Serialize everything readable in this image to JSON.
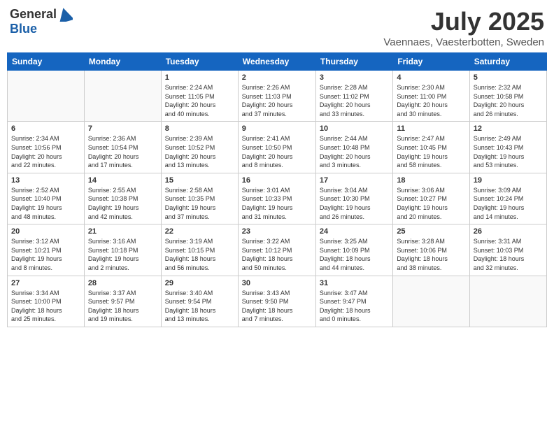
{
  "header": {
    "logo_general": "General",
    "logo_blue": "Blue",
    "month": "July 2025",
    "location": "Vaennaes, Vaesterbotten, Sweden"
  },
  "weekdays": [
    "Sunday",
    "Monday",
    "Tuesday",
    "Wednesday",
    "Thursday",
    "Friday",
    "Saturday"
  ],
  "weeks": [
    [
      {
        "day": "",
        "info": ""
      },
      {
        "day": "",
        "info": ""
      },
      {
        "day": "1",
        "info": "Sunrise: 2:24 AM\nSunset: 11:05 PM\nDaylight: 20 hours\nand 40 minutes."
      },
      {
        "day": "2",
        "info": "Sunrise: 2:26 AM\nSunset: 11:03 PM\nDaylight: 20 hours\nand 37 minutes."
      },
      {
        "day": "3",
        "info": "Sunrise: 2:28 AM\nSunset: 11:02 PM\nDaylight: 20 hours\nand 33 minutes."
      },
      {
        "day": "4",
        "info": "Sunrise: 2:30 AM\nSunset: 11:00 PM\nDaylight: 20 hours\nand 30 minutes."
      },
      {
        "day": "5",
        "info": "Sunrise: 2:32 AM\nSunset: 10:58 PM\nDaylight: 20 hours\nand 26 minutes."
      }
    ],
    [
      {
        "day": "6",
        "info": "Sunrise: 2:34 AM\nSunset: 10:56 PM\nDaylight: 20 hours\nand 22 minutes."
      },
      {
        "day": "7",
        "info": "Sunrise: 2:36 AM\nSunset: 10:54 PM\nDaylight: 20 hours\nand 17 minutes."
      },
      {
        "day": "8",
        "info": "Sunrise: 2:39 AM\nSunset: 10:52 PM\nDaylight: 20 hours\nand 13 minutes."
      },
      {
        "day": "9",
        "info": "Sunrise: 2:41 AM\nSunset: 10:50 PM\nDaylight: 20 hours\nand 8 minutes."
      },
      {
        "day": "10",
        "info": "Sunrise: 2:44 AM\nSunset: 10:48 PM\nDaylight: 20 hours\nand 3 minutes."
      },
      {
        "day": "11",
        "info": "Sunrise: 2:47 AM\nSunset: 10:45 PM\nDaylight: 19 hours\nand 58 minutes."
      },
      {
        "day": "12",
        "info": "Sunrise: 2:49 AM\nSunset: 10:43 PM\nDaylight: 19 hours\nand 53 minutes."
      }
    ],
    [
      {
        "day": "13",
        "info": "Sunrise: 2:52 AM\nSunset: 10:40 PM\nDaylight: 19 hours\nand 48 minutes."
      },
      {
        "day": "14",
        "info": "Sunrise: 2:55 AM\nSunset: 10:38 PM\nDaylight: 19 hours\nand 42 minutes."
      },
      {
        "day": "15",
        "info": "Sunrise: 2:58 AM\nSunset: 10:35 PM\nDaylight: 19 hours\nand 37 minutes."
      },
      {
        "day": "16",
        "info": "Sunrise: 3:01 AM\nSunset: 10:33 PM\nDaylight: 19 hours\nand 31 minutes."
      },
      {
        "day": "17",
        "info": "Sunrise: 3:04 AM\nSunset: 10:30 PM\nDaylight: 19 hours\nand 26 minutes."
      },
      {
        "day": "18",
        "info": "Sunrise: 3:06 AM\nSunset: 10:27 PM\nDaylight: 19 hours\nand 20 minutes."
      },
      {
        "day": "19",
        "info": "Sunrise: 3:09 AM\nSunset: 10:24 PM\nDaylight: 19 hours\nand 14 minutes."
      }
    ],
    [
      {
        "day": "20",
        "info": "Sunrise: 3:12 AM\nSunset: 10:21 PM\nDaylight: 19 hours\nand 8 minutes."
      },
      {
        "day": "21",
        "info": "Sunrise: 3:16 AM\nSunset: 10:18 PM\nDaylight: 19 hours\nand 2 minutes."
      },
      {
        "day": "22",
        "info": "Sunrise: 3:19 AM\nSunset: 10:15 PM\nDaylight: 18 hours\nand 56 minutes."
      },
      {
        "day": "23",
        "info": "Sunrise: 3:22 AM\nSunset: 10:12 PM\nDaylight: 18 hours\nand 50 minutes."
      },
      {
        "day": "24",
        "info": "Sunrise: 3:25 AM\nSunset: 10:09 PM\nDaylight: 18 hours\nand 44 minutes."
      },
      {
        "day": "25",
        "info": "Sunrise: 3:28 AM\nSunset: 10:06 PM\nDaylight: 18 hours\nand 38 minutes."
      },
      {
        "day": "26",
        "info": "Sunrise: 3:31 AM\nSunset: 10:03 PM\nDaylight: 18 hours\nand 32 minutes."
      }
    ],
    [
      {
        "day": "27",
        "info": "Sunrise: 3:34 AM\nSunset: 10:00 PM\nDaylight: 18 hours\nand 25 minutes."
      },
      {
        "day": "28",
        "info": "Sunrise: 3:37 AM\nSunset: 9:57 PM\nDaylight: 18 hours\nand 19 minutes."
      },
      {
        "day": "29",
        "info": "Sunrise: 3:40 AM\nSunset: 9:54 PM\nDaylight: 18 hours\nand 13 minutes."
      },
      {
        "day": "30",
        "info": "Sunrise: 3:43 AM\nSunset: 9:50 PM\nDaylight: 18 hours\nand 7 minutes."
      },
      {
        "day": "31",
        "info": "Sunrise: 3:47 AM\nSunset: 9:47 PM\nDaylight: 18 hours\nand 0 minutes."
      },
      {
        "day": "",
        "info": ""
      },
      {
        "day": "",
        "info": ""
      }
    ]
  ]
}
